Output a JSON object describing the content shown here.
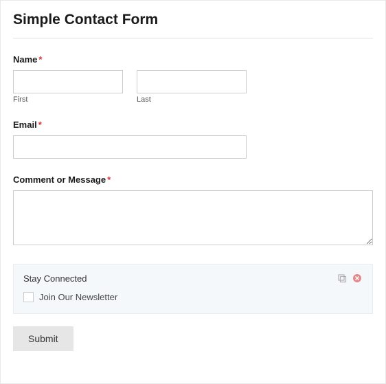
{
  "form": {
    "title": "Simple Contact Form",
    "name": {
      "label": "Name",
      "required": "*",
      "first_sublabel": "First",
      "last_sublabel": "Last",
      "first_value": "",
      "last_value": ""
    },
    "email": {
      "label": "Email",
      "required": "*",
      "value": ""
    },
    "comment": {
      "label": "Comment or Message",
      "required": "*",
      "value": ""
    },
    "stay_connected": {
      "title": "Stay Connected",
      "newsletter_label": "Join Our Newsletter"
    },
    "submit_label": "Submit"
  }
}
